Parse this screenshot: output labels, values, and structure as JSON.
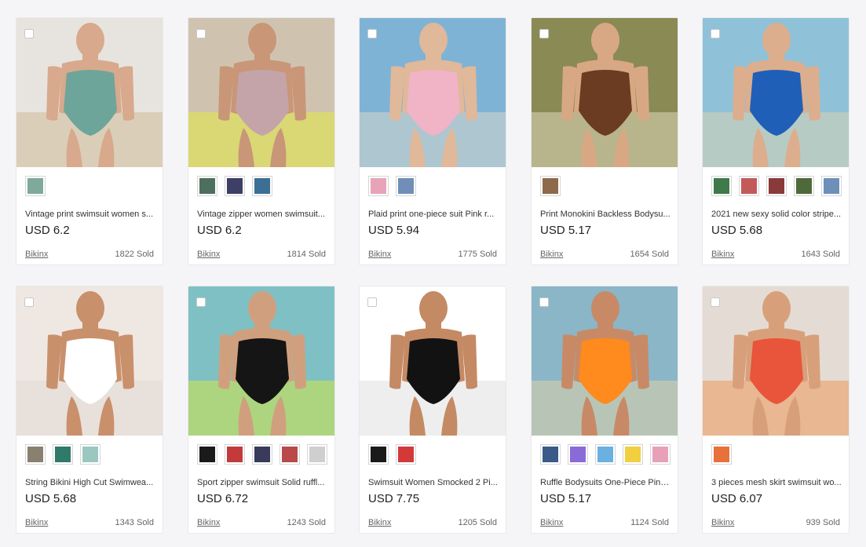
{
  "products": [
    {
      "title": "Vintage print swimsuit women s...",
      "price": "USD 6.2",
      "store": "Bikinx",
      "sold": "1822 Sold",
      "colors": {
        "bg": "#e7e4df",
        "skin": "#d8a98c",
        "suit": "#6ea59a",
        "accent": "#c9b48a"
      },
      "swatches": [
        "#7fa99a"
      ],
      "more_arrow": false
    },
    {
      "title": "Vintage zipper women swimsuit...",
      "price": "USD 6.2",
      "store": "Bikinx",
      "sold": "1814 Sold",
      "colors": {
        "bg": "#cfc3b0",
        "skin": "#c99678",
        "suit": "#c4a4a8",
        "accent": "#e7f02e"
      },
      "swatches": [
        "#4f6f5e",
        "#3d3f66",
        "#3b6f96"
      ],
      "more_arrow": false
    },
    {
      "title": "Plaid print one-piece suit Pink r...",
      "price": "USD 5.94",
      "store": "Bikinx",
      "sold": "1775 Sold",
      "colors": {
        "bg": "#7fb3d6",
        "skin": "#e0b89a",
        "suit": "#f1b3c6",
        "accent": "#e8ddc8"
      },
      "swatches": [
        "#e9a3b8",
        "#6f8fb8"
      ],
      "more_arrow": false
    },
    {
      "title": "Print Monokini Backless Bodysu...",
      "price": "USD 5.17",
      "store": "Bikinx",
      "sold": "1654 Sold",
      "colors": {
        "bg": "#8a8a55",
        "skin": "#d8a884",
        "suit": "#6b3b22",
        "accent": "#f0e6d0"
      },
      "swatches": [
        "#8d6a4a"
      ],
      "more_arrow": false
    },
    {
      "title": "2021 new sexy solid color stripe...",
      "price": "USD 5.68",
      "store": "Bikinx",
      "sold": "1643 Sold",
      "colors": {
        "bg": "#8fc2d8",
        "skin": "#dcae8e",
        "suit": "#1f5fb8",
        "accent": "#e8d7b0"
      },
      "swatches": [
        "#3f7a4a",
        "#c35a5a",
        "#8a3a3a",
        "#4f6a3a",
        "#6e8fb8"
      ],
      "more_arrow": false
    },
    {
      "title": "String Bikini High Cut Swimwea...",
      "price": "USD 5.68",
      "store": "Bikinx",
      "sold": "1343 Sold",
      "colors": {
        "bg": "#efe8e2",
        "skin": "#c9906c",
        "suit": "#ffffff",
        "accent": "#e0d8d0"
      },
      "swatches": [
        "#8a8070",
        "#2f7a6a",
        "#9ac8c0"
      ],
      "more_arrow": false
    },
    {
      "title": "Sport zipper swimsuit Solid ruffl...",
      "price": "USD 6.72",
      "store": "Bikinx",
      "sold": "1243 Sold",
      "colors": {
        "bg": "#7fc0c4",
        "skin": "#d0a07e",
        "suit": "#151515",
        "accent": "#e7f02e"
      },
      "swatches": [
        "#1a1a1a",
        "#c23a3a",
        "#3a3a5a",
        "#b84a4a",
        "#cfcfcf"
      ],
      "more_arrow": true
    },
    {
      "title": "Swimsuit Women Smocked 2 Pi...",
      "price": "USD 7.75",
      "store": "Bikinx",
      "sold": "1205 Sold",
      "colors": {
        "bg": "#ffffff",
        "skin": "#c48a64",
        "suit": "#121212",
        "accent": "#d9d9d9"
      },
      "swatches": [
        "#1a1a1a",
        "#d23a3a"
      ],
      "more_arrow": false
    },
    {
      "title": "Ruffle Bodysuits One-Piece Pink...",
      "price": "USD 5.17",
      "store": "Bikinx",
      "sold": "1124 Sold",
      "colors": {
        "bg": "#8ab6c8",
        "skin": "#c88a66",
        "suit": "#ff8a1e",
        "accent": "#f0d8a0"
      },
      "swatches": [
        "#3a5a8a",
        "#8a6ad8",
        "#6ab0e0",
        "#f0d040",
        "#e8a0b8"
      ],
      "more_arrow": true
    },
    {
      "title": "3 pieces mesh skirt swimsuit wo...",
      "price": "USD 6.07",
      "store": "Bikinx",
      "sold": "939 Sold",
      "colors": {
        "bg": "#e4dcd4",
        "skin": "#d8a07a",
        "suit": "#e8553a",
        "accent": "#f08a40"
      },
      "swatches": [
        "#e8703a"
      ],
      "more_arrow": false
    }
  ]
}
